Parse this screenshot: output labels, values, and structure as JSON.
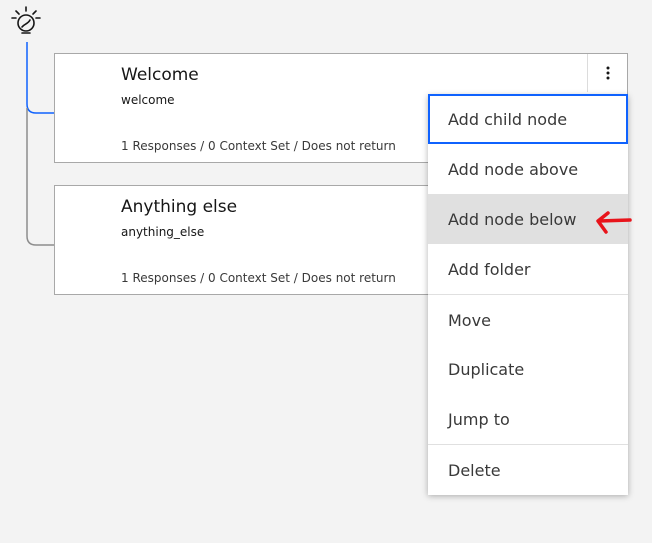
{
  "root": {
    "icon": "watson-bulb-icon"
  },
  "nodes": [
    {
      "title": "Welcome",
      "condition": "welcome",
      "summary": "1 Responses / 0 Context Set / Does not return"
    },
    {
      "title": "Anything else",
      "condition": "anything_else",
      "summary": "1 Responses / 0 Context Set / Does not return"
    }
  ],
  "overflow": {
    "icon": "overflow-menu-vertical-icon"
  },
  "menu": {
    "items": [
      {
        "label": "Add child node",
        "state": "focused"
      },
      {
        "label": "Add node above"
      },
      {
        "label": "Add node below",
        "state": "hover"
      },
      {
        "label": "Add folder"
      },
      {
        "label": "Move"
      },
      {
        "label": "Duplicate"
      },
      {
        "label": "Jump to"
      },
      {
        "label": "Delete"
      }
    ]
  },
  "annotation": {
    "icon": "red-arrow-icon",
    "color": "#e8141b"
  },
  "colors": {
    "focus": "#0f62fe",
    "tree_line_active": "#0f62fe",
    "tree_line": "#8d8d8d"
  }
}
